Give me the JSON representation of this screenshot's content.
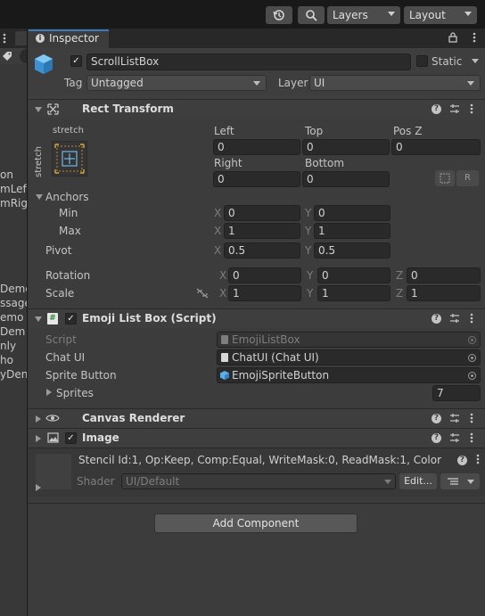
{
  "toolbar": {
    "layers_label": "Layers",
    "layout_label": "Layout",
    "history_icon": "history-icon",
    "search_icon": "search-icon"
  },
  "left_panel": {
    "items": [
      "on",
      "mLeft",
      "mRigh",
      "Demo",
      "ssage",
      "emo",
      "Dem",
      "nly",
      "ho",
      "yDen"
    ]
  },
  "inspector": {
    "tab_label": "Inspector",
    "object": {
      "name": "ScrollListBox",
      "static_label": "Static",
      "tag_label": "Tag",
      "tag_value": "Untagged",
      "layer_label": "Layer",
      "layer_value": "UI"
    },
    "rect_transform": {
      "title": "Rect Transform",
      "anchor_preset_top": "stretch",
      "anchor_preset_side": "stretch",
      "left_label": "Left",
      "top_label": "Top",
      "posz_label": "Pos Z",
      "left_value": "0",
      "top_value": "0",
      "posz_value": "0",
      "right_label": "Right",
      "bottom_label": "Bottom",
      "right_value": "0",
      "bottom_value": "0",
      "r_button": "R",
      "anchors_label": "Anchors",
      "min_label": "Min",
      "max_label": "Max",
      "min_x": "0",
      "min_y": "0",
      "max_x": "1",
      "max_y": "1",
      "pivot_label": "Pivot",
      "pivot_x": "0.5",
      "pivot_y": "0.5",
      "rotation_label": "Rotation",
      "rot_x": "0",
      "rot_y": "0",
      "rot_z": "0",
      "scale_label": "Scale",
      "scale_x": "1",
      "scale_y": "1",
      "scale_z": "1",
      "x": "X",
      "y": "Y",
      "z": "Z"
    },
    "emoji_script": {
      "title": "Emoji List Box (Script)",
      "script_label": "Script",
      "script_value": "EmojiListBox",
      "chat_label": "Chat UI",
      "chat_value": "ChatUI (Chat UI)",
      "sprite_button_label": "Sprite Button",
      "sprite_button_value": "EmojiSpriteButton",
      "sprites_label": "Sprites",
      "sprites_count": "7"
    },
    "canvas_renderer": {
      "title": "Canvas Renderer"
    },
    "image": {
      "title": "Image",
      "stencil_text": "Stencil Id:1, Op:Keep, Comp:Equal, WriteMask:0, ReadMask:1, Color",
      "shader_label": "Shader",
      "shader_value": "UI/Default",
      "edit_button": "Edit..."
    },
    "add_component": "Add Component"
  },
  "colors": {
    "accent": "#3a79bb",
    "panel": "#3c3c3c",
    "field": "#2a2a2a",
    "toolbar": "#191919"
  }
}
